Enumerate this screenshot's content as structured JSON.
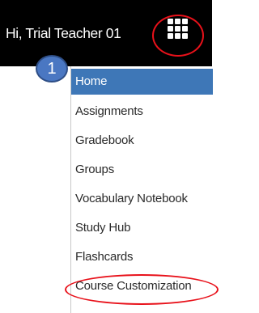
{
  "header": {
    "greeting": "Hi, Trial Teacher 01",
    "background_color": "#000000",
    "apps_icon": "apps-grid-icon"
  },
  "annotations": {
    "step_badge": "1",
    "badge_color": "#4a77c2",
    "highlight_color": "#e8111a"
  },
  "menu": {
    "active_color": "#3e77b7",
    "items": [
      {
        "label": "Home",
        "active": true
      },
      {
        "label": "Assignments",
        "active": false
      },
      {
        "label": "Gradebook",
        "active": false
      },
      {
        "label": "Groups",
        "active": false
      },
      {
        "label": "Vocabulary Notebook",
        "active": false
      },
      {
        "label": "Study Hub",
        "active": false
      },
      {
        "label": "Flashcards",
        "active": false
      },
      {
        "label": "Course Customization",
        "active": false
      }
    ]
  }
}
